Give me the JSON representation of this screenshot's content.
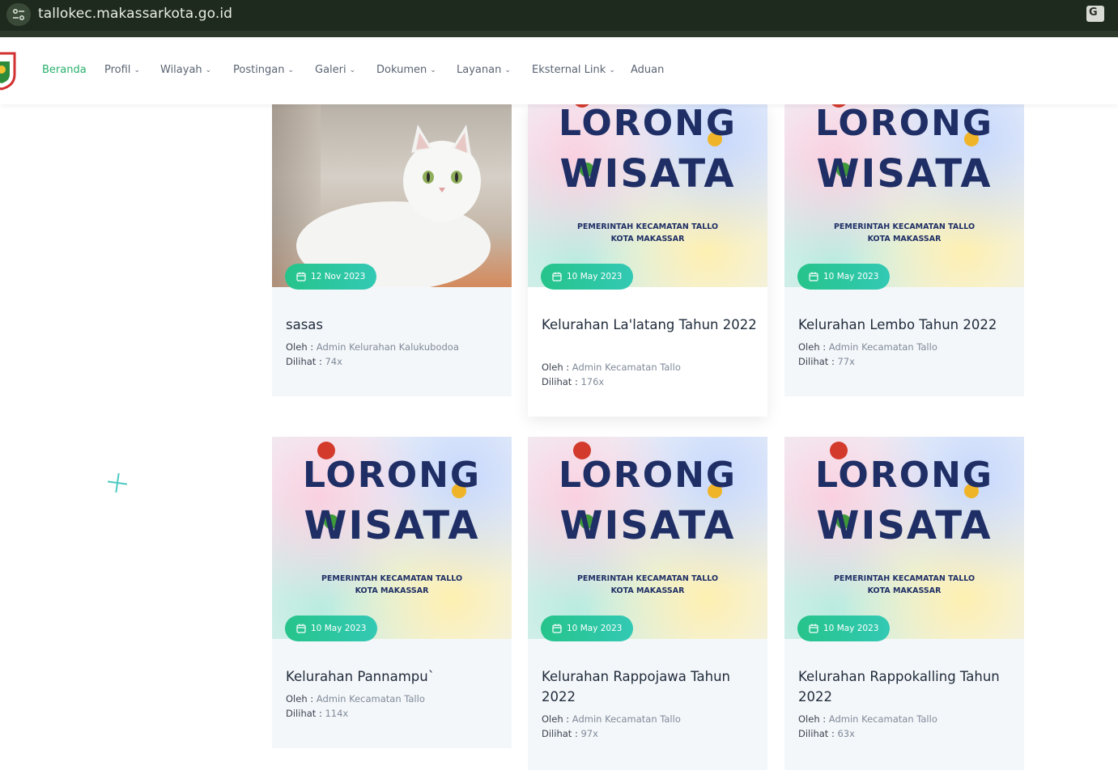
{
  "browser": {
    "url": "tallokec.makassarkota.go.id",
    "site_info_icon": "tune-icon",
    "translate_icon": "translate-icon",
    "translate_label": "G"
  },
  "nav": {
    "items": [
      {
        "label": "Beranda",
        "active": true,
        "dropdown": false
      },
      {
        "label": "Profil",
        "active": false,
        "dropdown": true
      },
      {
        "label": "Wilayah",
        "active": false,
        "dropdown": true
      },
      {
        "label": "Postingan",
        "active": false,
        "dropdown": true
      },
      {
        "label": "Galeri",
        "active": false,
        "dropdown": true
      },
      {
        "label": "Dokumen",
        "active": false,
        "dropdown": true
      },
      {
        "label": "Layanan",
        "active": false,
        "dropdown": true
      },
      {
        "label": "Eksternal Link",
        "active": false,
        "dropdown": true
      },
      {
        "label": "Aduan",
        "active": false,
        "dropdown": false
      }
    ],
    "chevron": "⌄"
  },
  "poster": {
    "word1": "LORONG",
    "word2": "WISATA",
    "sub1": "PEMERINTAH KECAMATAN TALLO",
    "sub2": "KOTA MAKASSAR"
  },
  "meta_labels": {
    "author": "Oleh : ",
    "views": "Dilihat : "
  },
  "posts": [
    {
      "date": "12 Nov 2023",
      "title": "sasas",
      "author": "Admin Kelurahan Kalukubodoa",
      "views": "74x",
      "image": "cat-photo"
    },
    {
      "date": "10 May 2023",
      "title": "Kelurahan La'latang Tahun 2022",
      "author": "Admin Kecamatan Tallo",
      "views": "176x",
      "image": "lorong-wisata-poster"
    },
    {
      "date": "10 May 2023",
      "title": "Kelurahan Lembo Tahun 2022",
      "author": "Admin Kecamatan Tallo",
      "views": "77x",
      "image": "lorong-wisata-poster"
    },
    {
      "date": "10 May 2023",
      "title": "Kelurahan Pannampu`",
      "author": "Admin Kecamatan Tallo",
      "views": "114x",
      "image": "lorong-wisata-poster"
    },
    {
      "date": "10 May 2023",
      "title": "Kelurahan Rappojawa Tahun 2022",
      "author": "Admin Kecamatan Tallo",
      "views": "97x",
      "image": "lorong-wisata-poster"
    },
    {
      "date": "10 May 2023",
      "title": "Kelurahan Rappokalling Tahun 2022",
      "author": "Admin Kecamatan Tallo",
      "views": "63x",
      "image": "lorong-wisata-poster"
    }
  ],
  "colors": {
    "accent_green": "#27b06b",
    "badge_start": "#26c48b",
    "badge_end": "#33c9b4",
    "title_text": "#1f2b3a",
    "poster_text": "#1f2f66"
  }
}
